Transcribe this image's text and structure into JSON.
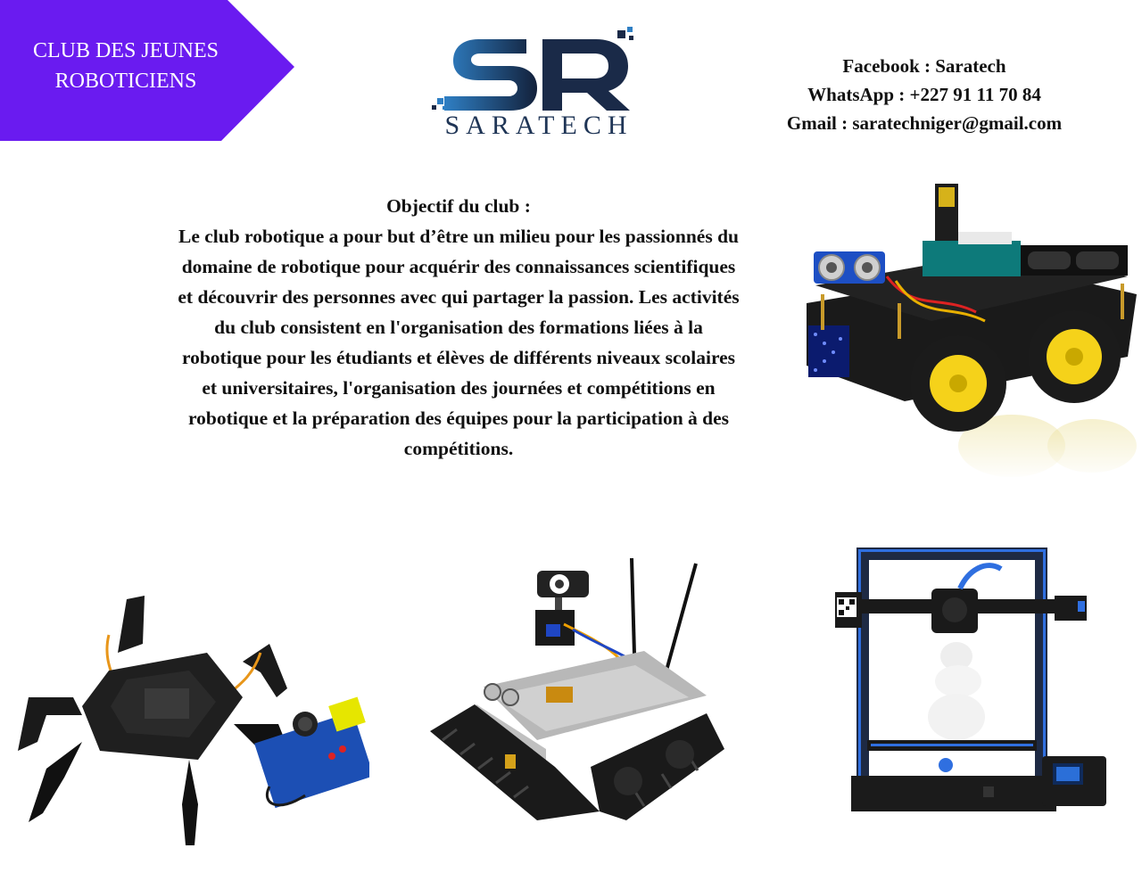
{
  "banner": {
    "line1": "CLUB DES JEUNES",
    "line2": "ROBOTICIENS",
    "color": "#6a1bf0"
  },
  "logo": {
    "wordmark": "SARATECH",
    "colors": {
      "dark": "#1a2a48",
      "blue": "#2f7fc4"
    }
  },
  "contacts": {
    "facebook": "Facebook : Saratech",
    "whatsapp": "WhatsApp : +227 91 11 70 84",
    "gmail": "Gmail : saratechniger@gmail.com"
  },
  "objective": {
    "title": "Objectif du club :",
    "lines": [
      "Le club robotique a pour but d’être un milieu pour les passionnés du",
      "domaine de robotique pour acquérir des connaissances scientifiques",
      "et découvrir des personnes avec qui partager la passion. Les activités",
      "du club consistent en l'organisation des formations liées à la",
      "robotique pour les étudiants et élèves de différents niveaux scolaires",
      "et universitaires, l'organisation des journées et compétitions en",
      "robotique et la préparation des équipes pour la participation à des",
      "compétitions."
    ]
  },
  "images": {
    "car": "robot-car-kit-image",
    "spider": "hexapod-spider-robot-image",
    "tank": "tank-robot-with-camera-image",
    "printer": "3d-printer-image"
  }
}
